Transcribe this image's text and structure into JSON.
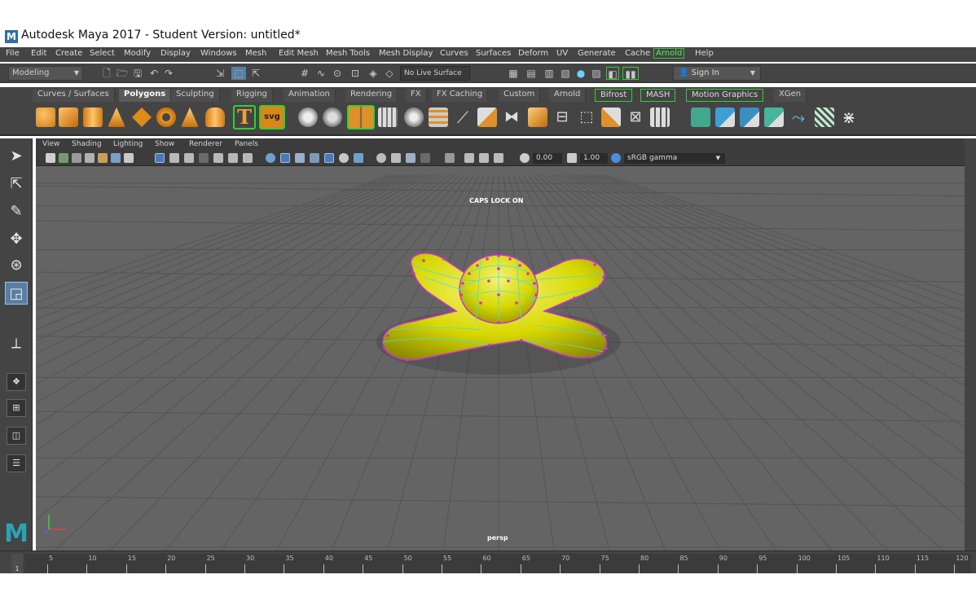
{
  "window": {
    "title": "Autodesk Maya 2017 - Student Version: untitled*",
    "logo_letter": "M"
  },
  "menubar": {
    "items": [
      "File",
      "Edit",
      "Create",
      "Select",
      "Modify",
      "Display",
      "Windows",
      "Mesh",
      "Edit Mesh",
      "Mesh Tools",
      "Mesh Display",
      "Curves",
      "Surfaces",
      "Deform",
      "UV",
      "Generate",
      "Cache",
      "Arnold",
      "Help"
    ]
  },
  "statusline": {
    "mode": "Modeling",
    "live_surface": "No Live Surface",
    "sign_in": "Sign In"
  },
  "shelf": {
    "tabs": [
      "Curves / Surfaces",
      "Polygons",
      "Sculpting",
      "Rigging",
      "Animation",
      "Rendering",
      "FX",
      "FX Caching",
      "Custom",
      "Arnold",
      "Bifrost",
      "MASH",
      "Motion Graphics",
      "XGen"
    ],
    "active_tab": "Polygons",
    "icon_text_T": "T",
    "icon_text_svg": "svg"
  },
  "panel": {
    "menu": [
      "View",
      "Shading",
      "Lighting",
      "Show",
      "Renderer",
      "Panels"
    ],
    "exposure": "0.00",
    "gamma": "1.00",
    "color_space": "sRGB gamma",
    "caps_lock": "CAPS LOCK ON",
    "camera": "persp"
  },
  "timeline": {
    "current_frame": "1",
    "ticks": [
      "5",
      "10",
      "15",
      "20",
      "25",
      "30",
      "35",
      "40",
      "45",
      "50",
      "55",
      "60",
      "65",
      "70",
      "75",
      "80",
      "85",
      "90",
      "95",
      "100",
      "105",
      "110",
      "115",
      "120"
    ]
  },
  "colors": {
    "ui_bg": "#444444",
    "viewport_bg": "#646464",
    "mesh_yellow": "#e6e600",
    "selection_magenta": "#cc33cc",
    "wire_cyan": "#40e0e0",
    "bracket_green": "#2fd12f"
  }
}
